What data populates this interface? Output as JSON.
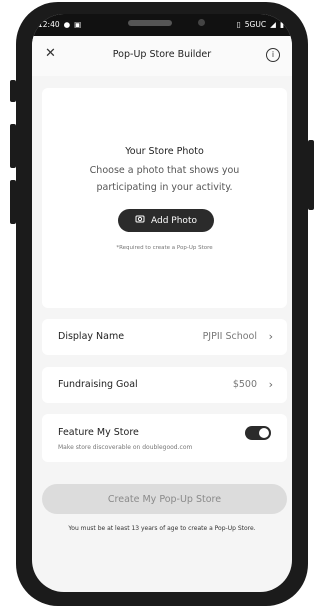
{
  "status_bar": {
    "time": "12:40",
    "left_icons": [
      "chat-icon",
      "calendar-icon"
    ],
    "network": "5GUC",
    "right_icons": [
      "vibrate-icon",
      "signal-icon",
      "battery-icon"
    ]
  },
  "header": {
    "close_icon": "close-icon",
    "title": "Pop-Up Store Builder",
    "info_icon": "info-icon"
  },
  "photo_card": {
    "title": "Your Store Photo",
    "subtitle": "Choose a photo that shows you participating in your activity.",
    "button_label": "Add Photo",
    "button_icon": "camera-icon",
    "requirement": "*Required to create a Pop-Up Store"
  },
  "rows": [
    {
      "label": "Display Name",
      "value": "PJPII School"
    },
    {
      "label": "Fundraising Goal",
      "value": "$500"
    }
  ],
  "feature": {
    "label": "Feature My Store",
    "subtitle": "Make store discoverable on doublegood.com",
    "enabled": true
  },
  "cta": {
    "label": "Create My Pop-Up Store"
  },
  "age_notice": "You must be at least 13 years of age to create a Pop-Up Store."
}
